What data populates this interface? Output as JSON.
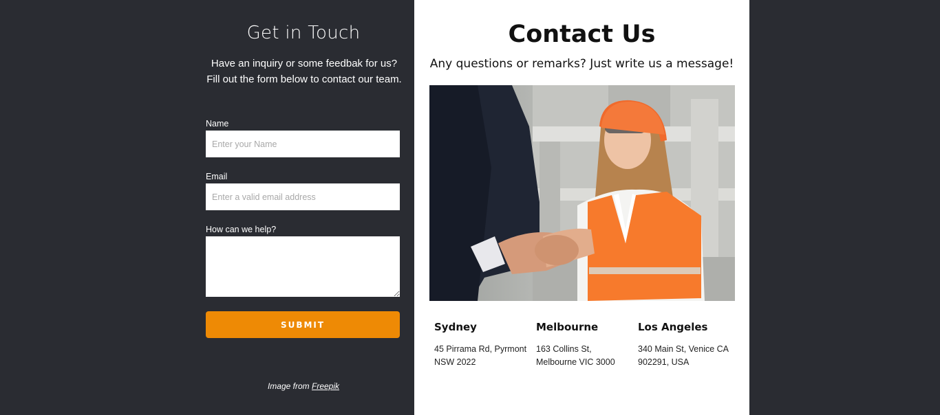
{
  "form": {
    "title": "Get in Touch",
    "intro": "Have an inquiry or some feedbak for us? Fill out the form below to contact our team.",
    "name_label": "Name",
    "name_placeholder": "Enter your Name",
    "email_label": "Email",
    "email_placeholder": "Enter a valid email address",
    "help_label": "How can we help?",
    "submit_label": "SUBMIT",
    "credit_prefix": "Image from ",
    "credit_link": "Freepik"
  },
  "contact": {
    "title": "Contact Us",
    "subtitle": "Any questions or remarks? Just write us a message!",
    "image_icon": "handshake-photo",
    "offices": [
      {
        "city": "Sydney",
        "address_line1": "45 Pirrama Rd, Pyrmont",
        "address_line2": "NSW 2022"
      },
      {
        "city": "Melbourne",
        "address_line1": "163 Collins St,",
        "address_line2": "Melbourne VIC 3000"
      },
      {
        "city": "Los Angeles",
        "address_line1": "340 Main St, Venice CA",
        "address_line2": "902291, USA"
      }
    ]
  },
  "colors": {
    "background": "#2a2c32",
    "accent": "#ee8a05",
    "panel": "#ffffff"
  }
}
